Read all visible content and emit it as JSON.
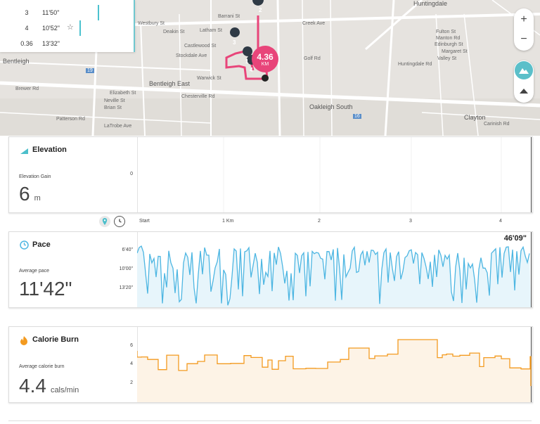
{
  "map": {
    "splits": [
      {
        "key": "3",
        "value": "11'50\"",
        "starred": false,
        "bar_fraction": 0.6
      },
      {
        "key": "4",
        "value": "10'52\"",
        "starred": true,
        "bar_fraction": 0.85
      },
      {
        "key": "0.36",
        "value": "13'32\"",
        "starred": false,
        "bar_fraction": 1.0
      }
    ],
    "distance_value": "4.36",
    "distance_unit": "KM",
    "markers": [
      "1",
      "2",
      "3",
      "4"
    ],
    "labels": {
      "huntingdale": "Huntingdale",
      "bentleigh": "Bentleigh",
      "bentleigh_east": "Bentleigh East",
      "oakleigh_south": "Oakleigh South",
      "clayton": "Clayton",
      "barrani_st": "Barrani St",
      "latham_st": "Latham St",
      "deakin_st": "Deakin St",
      "westbury_st": "Westbury St",
      "castlewood_st": "Castlewood St",
      "stockdale_ave": "Stockdale Ave",
      "warwick_st": "Warwick St",
      "brewer_rd": "Brewer Rd",
      "elizabeth_st": "Elizabeth St",
      "neville_st": "Neville St",
      "brian_st": "Brian St",
      "patterson_rd": "Patterson Rd",
      "latrobe_ave": "LaTrobe Ave",
      "chesterville_rd": "Chesterville Rd",
      "valley_st": "Valley St",
      "fulton_st": "Fulton St",
      "manton_rd": "Manton Rd",
      "edinburgh_st": "Edinburgh St",
      "margaret_st": "Margaret St",
      "carinish_rd": "Carinish Rd",
      "huntingdale_rd": "Huntingdale Rd",
      "golf_rd": "Golf Rd",
      "creek_ave": "Creek Ave",
      "route_19": "19",
      "route_16": "16"
    },
    "zoom_in": "+",
    "zoom_out": "−"
  },
  "elevation": {
    "title": "Elevation",
    "stat_label": "Elevation Gain",
    "stat_value": "6",
    "stat_unit": "m",
    "ytick": "0"
  },
  "axis": {
    "ticks": [
      "Start",
      "1 Km",
      "2",
      "3",
      "4"
    ]
  },
  "pace": {
    "title": "Pace",
    "stat_label": "Average pace",
    "stat_value": "11'42\"",
    "yticks": [
      "6'40\"",
      "10'00\"",
      "13'20\""
    ],
    "total_time": "46'09\"",
    "color": "#4db6e2"
  },
  "calorie": {
    "title": "Calorie Burn",
    "stat_label": "Average calorie burn",
    "stat_value": "4.4",
    "stat_unit": "cals/min",
    "yticks": [
      "6",
      "4",
      "2"
    ],
    "color": "#f39a1f"
  }
}
